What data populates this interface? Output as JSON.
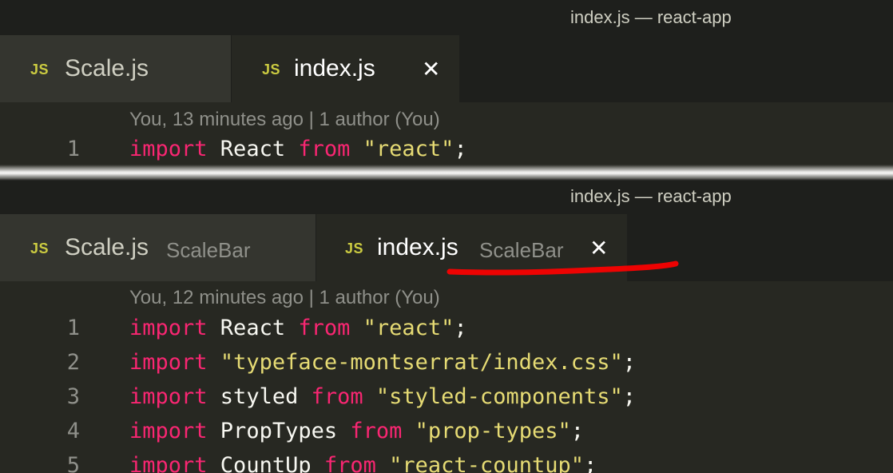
{
  "top": {
    "window_title": "index.js — react-app",
    "tabs": [
      {
        "icon": "JS",
        "label": "Scale.js",
        "active": false
      },
      {
        "icon": "JS",
        "label": "index.js",
        "active": true,
        "close": "✕"
      }
    ],
    "blame": "You, 13 minutes ago | 1 author (You)",
    "lines": [
      {
        "number": "1",
        "tokens": [
          {
            "text": "import",
            "type": "kw"
          },
          {
            "text": " React ",
            "type": "plain"
          },
          {
            "text": "from",
            "type": "kw"
          },
          {
            "text": " ",
            "type": "plain"
          },
          {
            "text": "\"react\"",
            "type": "str"
          },
          {
            "text": ";",
            "type": "plain"
          }
        ]
      }
    ]
  },
  "bottom": {
    "window_title": "index.js — react-app",
    "tabs": [
      {
        "icon": "JS",
        "label": "Scale.js",
        "description": "ScaleBar",
        "active": false
      },
      {
        "icon": "JS",
        "label": "index.js",
        "description": "ScaleBar",
        "active": true,
        "close": "✕"
      }
    ],
    "blame": "You, 12 minutes ago | 1 author (You)",
    "lines": [
      {
        "number": "1",
        "tokens": [
          {
            "text": "import",
            "type": "kw"
          },
          {
            "text": " React ",
            "type": "plain"
          },
          {
            "text": "from",
            "type": "kw"
          },
          {
            "text": " ",
            "type": "plain"
          },
          {
            "text": "\"react\"",
            "type": "str"
          },
          {
            "text": ";",
            "type": "plain"
          }
        ]
      },
      {
        "number": "2",
        "tokens": [
          {
            "text": "import",
            "type": "kw"
          },
          {
            "text": " ",
            "type": "plain"
          },
          {
            "text": "\"typeface-montserrat/index.css\"",
            "type": "str"
          },
          {
            "text": ";",
            "type": "plain"
          }
        ]
      },
      {
        "number": "3",
        "tokens": [
          {
            "text": "import",
            "type": "kw"
          },
          {
            "text": " styled ",
            "type": "plain"
          },
          {
            "text": "from",
            "type": "kw"
          },
          {
            "text": " ",
            "type": "plain"
          },
          {
            "text": "\"styled-components\"",
            "type": "str"
          },
          {
            "text": ";",
            "type": "plain"
          }
        ]
      },
      {
        "number": "4",
        "tokens": [
          {
            "text": "import",
            "type": "kw"
          },
          {
            "text": " PropTypes ",
            "type": "plain"
          },
          {
            "text": "from",
            "type": "kw"
          },
          {
            "text": " ",
            "type": "plain"
          },
          {
            "text": "\"prop-types\"",
            "type": "str"
          },
          {
            "text": ";",
            "type": "plain"
          }
        ]
      },
      {
        "number": "5",
        "tokens": [
          {
            "text": "import",
            "type": "kw"
          },
          {
            "text": " CountUp ",
            "type": "plain"
          },
          {
            "text": "from",
            "type": "kw"
          },
          {
            "text": " ",
            "type": "plain"
          },
          {
            "text": "\"react-countup\"",
            "type": "str"
          },
          {
            "text": ";",
            "type": "plain"
          }
        ]
      }
    ]
  },
  "colors": {
    "editor_bg": "#272822",
    "tab_inactive_bg": "#34352f",
    "keyword": "#f92672",
    "string": "#e6db74",
    "js_icon": "#cbcb41",
    "annotation": "#ff0000"
  }
}
